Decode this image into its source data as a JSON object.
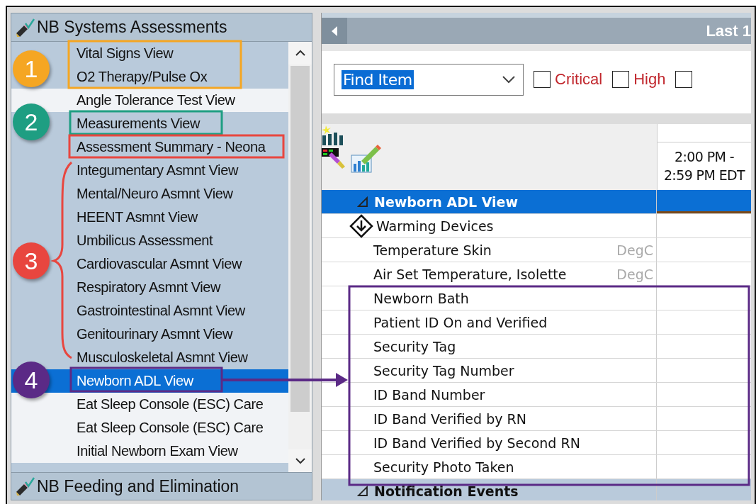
{
  "left_panel": {
    "title": "NB Systems Assessments",
    "items": [
      {
        "label": "Vital Signs View",
        "kind": "shaded",
        "selected": false
      },
      {
        "label": "O2 Therapy/Pulse Ox",
        "kind": "shaded",
        "selected": false
      },
      {
        "label": "Angle Tolerance Test View",
        "kind": "plain",
        "selected": false
      },
      {
        "label": "Measurements View",
        "kind": "shaded",
        "selected": false
      },
      {
        "label": "Assessment Summary - Neona",
        "kind": "shaded",
        "selected": false
      },
      {
        "label": "Integumentary Asmnt View",
        "kind": "shaded",
        "selected": false
      },
      {
        "label": "Mental/Neuro Asmnt View",
        "kind": "shaded",
        "selected": false
      },
      {
        "label": "HEENT Asmnt View",
        "kind": "shaded",
        "selected": false
      },
      {
        "label": "Umbilicus Assessment",
        "kind": "shaded",
        "selected": false
      },
      {
        "label": "Cardiovascular Asmnt View",
        "kind": "shaded",
        "selected": false
      },
      {
        "label": "Respiratory Asmnt View",
        "kind": "shaded",
        "selected": false
      },
      {
        "label": "Gastrointestinal Asmnt View",
        "kind": "shaded",
        "selected": false
      },
      {
        "label": "Genitourinary Asmnt View",
        "kind": "shaded",
        "selected": false
      },
      {
        "label": "Musculoskeletal Asmnt View",
        "kind": "shaded",
        "selected": false
      },
      {
        "label": "Newborn ADL View",
        "kind": "shaded",
        "selected": true
      },
      {
        "label": "Eat Sleep Console (ESC) Care",
        "kind": "plain",
        "selected": false
      },
      {
        "label": "Eat Sleep Console (ESC) Care",
        "kind": "plain",
        "selected": false
      },
      {
        "label": "Initial Newborn Exam View",
        "kind": "plain",
        "selected": false
      }
    ],
    "footer": "NB Feeding and Elimination"
  },
  "right_panel": {
    "range_label": "Last 1",
    "find": {
      "value": "Find Item"
    },
    "filters": [
      {
        "label": "Critical",
        "checked": false
      },
      {
        "label": "High",
        "checked": false
      },
      {
        "checked": false
      }
    ],
    "time_column": "2:00 PM - 2:59 PM EDT",
    "rows": [
      {
        "label": "Newborn ADL View",
        "kind": "section",
        "expanded": true,
        "selected": true
      },
      {
        "label": "Warming Devices",
        "kind": "group",
        "selected": false
      },
      {
        "label": "Temperature Skin",
        "kind": "item",
        "unit": "DegC",
        "selected": false
      },
      {
        "label": "Air Set Temperature, Isolette",
        "kind": "item",
        "unit": "DegC",
        "selected": false
      },
      {
        "label": "Newborn Bath",
        "kind": "item",
        "selected": false
      },
      {
        "label": "Patient ID On and Verified",
        "kind": "item",
        "selected": false
      },
      {
        "label": "Security Tag",
        "kind": "item",
        "selected": false
      },
      {
        "label": "Security Tag Number",
        "kind": "item",
        "selected": false
      },
      {
        "label": "ID Band Number",
        "kind": "item",
        "selected": false
      },
      {
        "label": "ID Band Verified by RN",
        "kind": "item",
        "selected": false
      },
      {
        "label": "ID Band Verified by Second RN",
        "kind": "item",
        "selected": false
      },
      {
        "label": "Security Photo Taken",
        "kind": "item",
        "selected": false
      },
      {
        "label": "Notification Events",
        "kind": "section",
        "expanded": true,
        "selected": false
      }
    ]
  },
  "annotations": [
    {
      "label": "1",
      "color": "#f5a623"
    },
    {
      "label": "2",
      "color": "#1e9e82"
    },
    {
      "label": "3",
      "color": "#e8463f"
    },
    {
      "label": "4",
      "color": "#5b2a86"
    }
  ]
}
